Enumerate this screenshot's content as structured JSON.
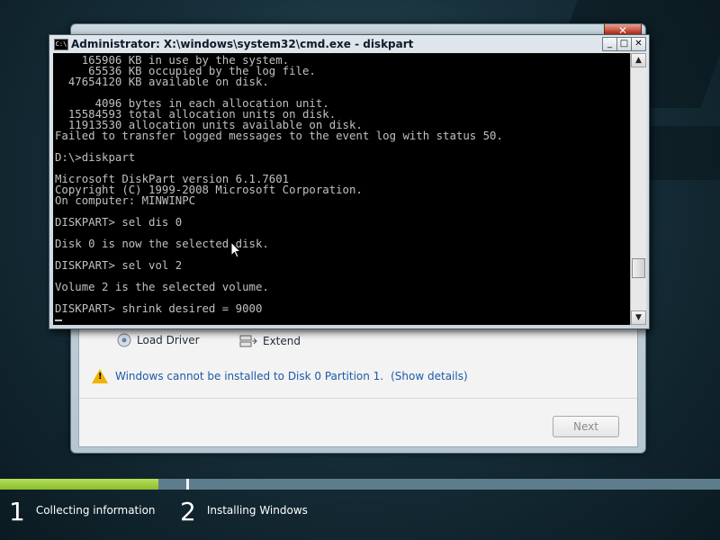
{
  "setup": {
    "close_glyph": "✕",
    "load_driver_label": "Load Driver",
    "extend_label": "Extend",
    "warning_text": "Windows cannot be installed to Disk 0 Partition 1.",
    "show_details_label": "(Show details)",
    "next_label": "Next"
  },
  "cmd": {
    "title": "Administrator: X:\\windows\\system32\\cmd.exe - diskpart",
    "icon_label": "C:\\",
    "minimize_glyph": "_",
    "maximize_glyph": "□",
    "close_glyph": "✕",
    "scroll_up_glyph": "▲",
    "scroll_down_glyph": "▼",
    "console_text": "    165906 KB in use by the system.\n     65536 KB occupied by the log file.\n  47654120 KB available on disk.\n\n      4096 bytes in each allocation unit.\n  15584593 total allocation units on disk.\n  11913530 allocation units available on disk.\nFailed to transfer logged messages to the event log with status 50.\n\nD:\\>diskpart\n\nMicrosoft DiskPart version 6.1.7601\nCopyright (C) 1999-2008 Microsoft Corporation.\nOn computer: MINWINPC\n\nDISKPART> sel dis 0\n\nDisk 0 is now the selected disk.\n\nDISKPART> sel vol 2\n\nVolume 2 is the selected volume.\n\nDISKPART> shrink desired = 9000"
  },
  "progress": {
    "steps": [
      {
        "number": "1",
        "label": "Collecting information"
      },
      {
        "number": "2",
        "label": "Installing Windows"
      }
    ]
  },
  "colors": {
    "progress_fill": "#8bbd2d",
    "console_text": "#c0c0c0",
    "link": "#1c5aa8"
  }
}
